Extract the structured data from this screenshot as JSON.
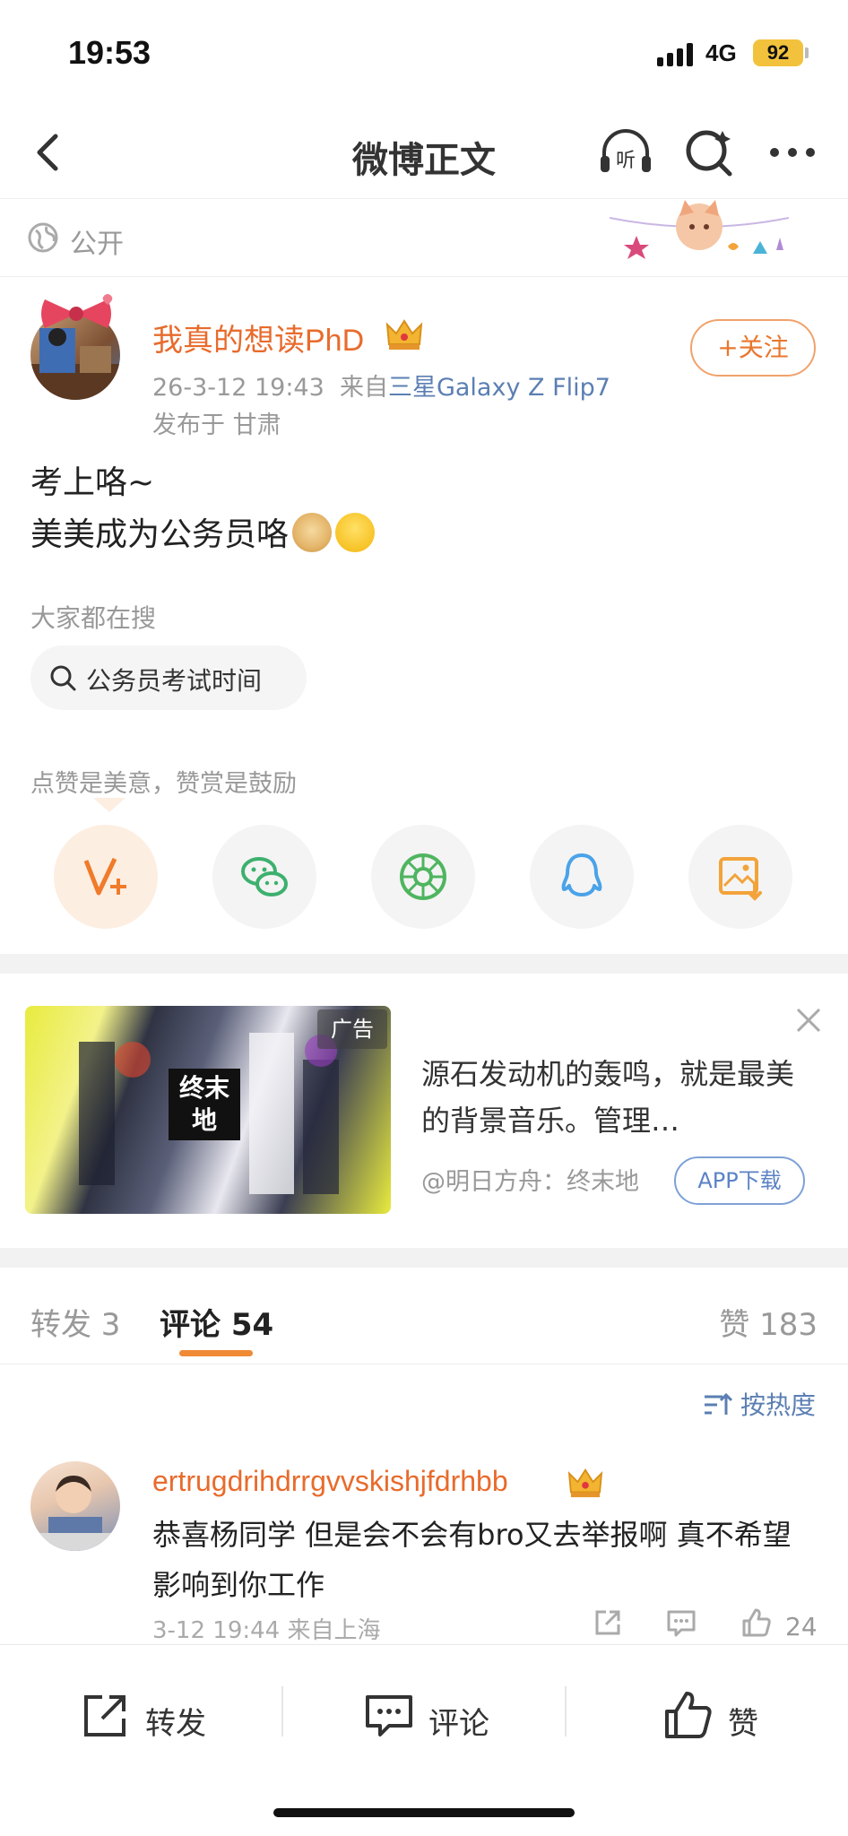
{
  "status_bar": {
    "time": "19:53",
    "network": "4G",
    "battery": "92"
  },
  "nav": {
    "title": "微博正文",
    "listen_label": "听"
  },
  "visibility": {
    "label": "公开"
  },
  "post": {
    "author_name": "我真的想读PhD",
    "date": "26-3-12 19:43",
    "source_prefix": "来自",
    "device": "三星Galaxy Z Flip7",
    "location": "发布于 甘肃",
    "follow_label": "+关注",
    "text_line1": "考上咯~",
    "text_line2": "美美成为公务员咯"
  },
  "hot_search": {
    "label": "大家都在搜",
    "query": "公务员考试时间"
  },
  "reward": {
    "label": "点赞是美意，赞赏是鼓励"
  },
  "ad": {
    "tag": "广告",
    "logo_text": "终末地",
    "title": "源石发动机的轰鸣，就是最美的背景音乐。管理…",
    "source": "@明日方舟：终末地",
    "button": "APP下载"
  },
  "tabs": {
    "repost": "转发 3",
    "comments": "评论 54",
    "likes": "赞 183"
  },
  "sort_label": "按热度",
  "comments": [
    {
      "name": "ertrugdrihdrrgvvskishjfdrhbb",
      "text": "恭喜杨同学 但是会不会有bro又去举报啊 真不希望影响到你工作",
      "meta": "3-12 19:44 来自上海",
      "likes": "24"
    }
  ],
  "bottom_bar": {
    "repost": "转发",
    "comment": "评论",
    "like": "赞"
  },
  "colors": {
    "accent_orange": "#e86b2c",
    "link_blue": "#5b7fb3",
    "tab_underline": "#f08a35"
  }
}
